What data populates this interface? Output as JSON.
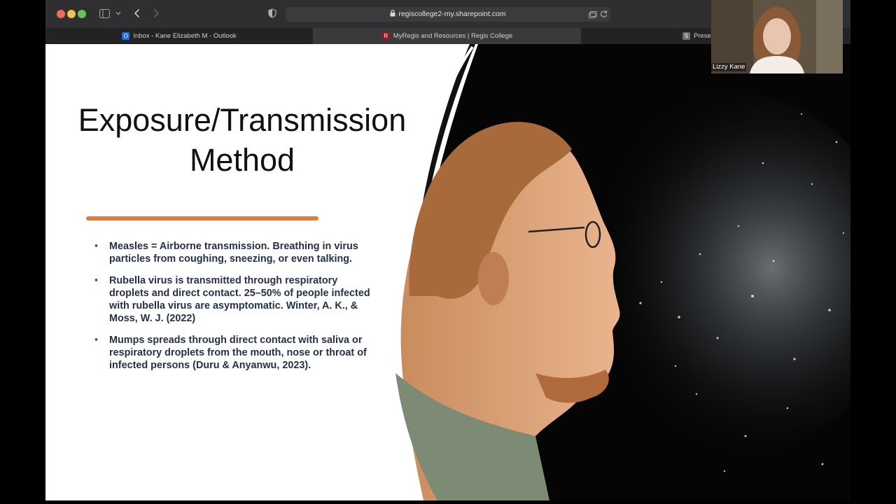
{
  "browser": {
    "url": "regiscollege2-my.sharepoint.com",
    "tabs": [
      {
        "label": "Inbox - Kane Elizabeth M - Outlook",
        "icon": "outlook-icon"
      },
      {
        "label": "MyRegis and Resources | Regis College",
        "icon": "regis-icon"
      },
      {
        "label": "Presen",
        "icon": "sharepoint-icon"
      }
    ]
  },
  "slide": {
    "title_line1": "Exposure/Transmission",
    "title_line2": "Method",
    "accent_color": "#e07b43",
    "bullets": [
      "Measles = Airborne transmission. Breathing in virus particles from coughing, sneezing, or even talking.",
      "Rubella virus is transmitted through respiratory droplets and direct contact. 25–50% of people infected with rubella virus are asymptomatic. Winter, A. K., & Moss, W. J. (2022)",
      "Mumps spreads through direct contact with saliva or respiratory droplets from the mouth, nose or throat of infected persons (Duru & Anyanwu, 2023)."
    ]
  },
  "video": {
    "participant_name": "Lizzy Kane"
  }
}
